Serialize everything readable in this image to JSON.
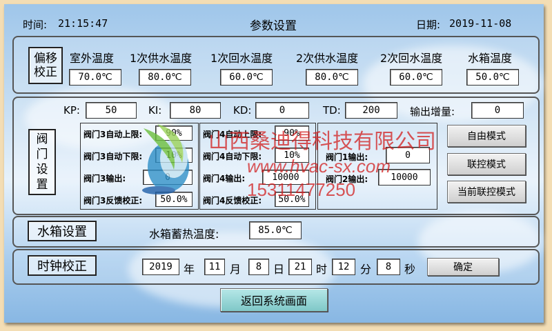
{
  "header": {
    "time_label": "时间:",
    "time": "21:15:47",
    "title": "参数设置",
    "date_label": "日期:",
    "date": "2019-11-08"
  },
  "offset": {
    "section_label": "偏移校正",
    "columns": [
      {
        "label": "室外温度",
        "value": "70.0℃"
      },
      {
        "label": "1次供水温度",
        "value": "80.0℃"
      },
      {
        "label": "1次回水温度",
        "value": "60.0℃"
      },
      {
        "label": "2次供水温度",
        "value": "80.0℃"
      },
      {
        "label": "2次回水温度",
        "value": "60.0℃"
      },
      {
        "label": "水箱温度",
        "value": "50.0℃"
      }
    ]
  },
  "pid": {
    "kp_label": "KP:",
    "kp": "50",
    "ki_label": "KI:",
    "ki": "80",
    "kd_label": "KD:",
    "kd": "0",
    "td_label": "TD:",
    "td": "200",
    "gain_label": "输出增量:",
    "gain": "0"
  },
  "valve": {
    "section_label": "阀门设置",
    "valve3": {
      "upper_label": "阀门3自动上限:",
      "upper": "90%",
      "lower_label": "阀门3自动下限:",
      "lower": "10%",
      "output_label": "阀门3输出:",
      "output": "0",
      "feedback_label": "阀门3反馈校正:",
      "feedback": "50.0%"
    },
    "valve4": {
      "upper_label": "阀门4自动上限:",
      "upper": "90%",
      "lower_label": "阀门4自动下限:",
      "lower": "10%",
      "output_label": "阀门4输出:",
      "output": "10000",
      "feedback_label": "阀门4反馈校正:",
      "feedback": "50.0%"
    },
    "valve12": {
      "v1_label": "阀门1输出:",
      "v1": "0",
      "v2_label": "阀门2输出:",
      "v2": "10000"
    },
    "buttons": {
      "free_mode": "自由模式",
      "linked_mode": "联控模式",
      "current_mode": "当前联控模式"
    }
  },
  "tank": {
    "section_label": "水箱设置",
    "storage_label": "水箱蓄热温度:",
    "storage": "85.0℃"
  },
  "clock": {
    "section_label": "时钟校正",
    "year": "2019",
    "year_unit": "年",
    "month": "11",
    "month_unit": "月",
    "day": "8",
    "day_unit": "日",
    "hour": "21",
    "hour_unit": "时",
    "minute": "12",
    "minute_unit": "分",
    "second": "8",
    "second_unit": "秒",
    "confirm": "确定"
  },
  "return_button": "返回系统画面",
  "watermark": {
    "company": "山西桑迪得科技有限公司",
    "url": "www.hvac-sx.com",
    "phone": "15311477250"
  },
  "colors": {
    "return_button": "#8fd3d3",
    "watermark": "#d21e1e"
  }
}
